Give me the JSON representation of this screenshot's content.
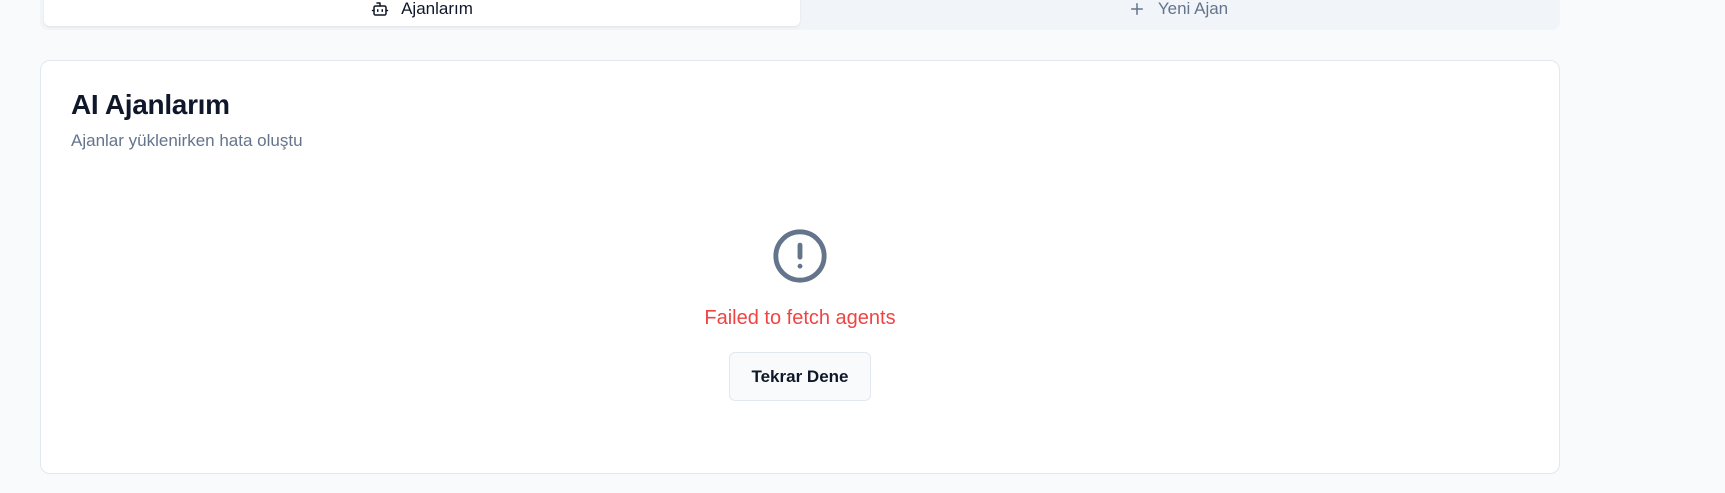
{
  "tabs": [
    {
      "label": "Ajanlarım",
      "icon": "bot-icon",
      "active": true
    },
    {
      "label": "Yeni Ajan",
      "icon": "plus-icon",
      "active": false
    }
  ],
  "card": {
    "title": "AI Ajanlarım",
    "description": "Ajanlar yüklenirken hata oluştu"
  },
  "error": {
    "icon": "alert-circle-icon",
    "message": "Failed to fetch agents",
    "retry_label": "Tekrar Dene"
  },
  "colors": {
    "background": "#f8fafc",
    "error": "#ef4444",
    "muted": "#64748b",
    "icon": "#64748b"
  }
}
